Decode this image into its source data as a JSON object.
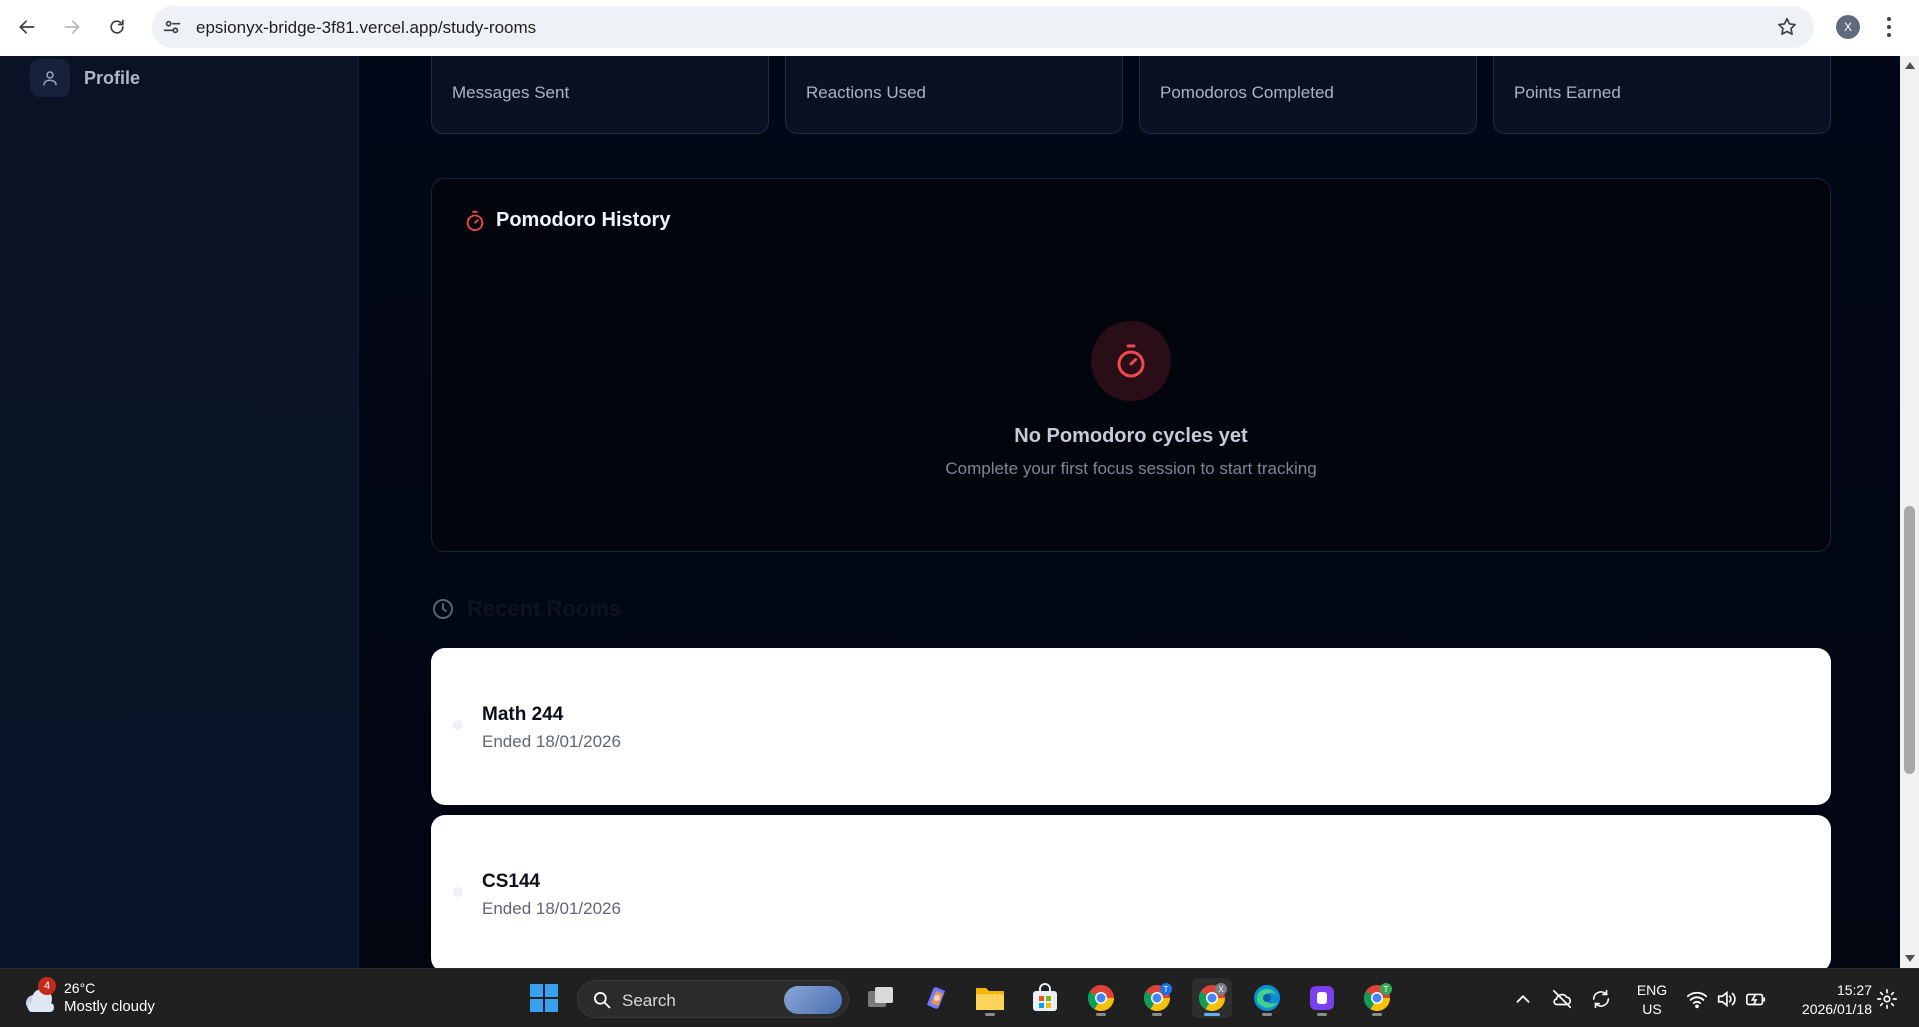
{
  "browser": {
    "url": "epsionyx-bridge-3f81.vercel.app/study-rooms",
    "profile_initial": "X"
  },
  "sidebar": {
    "items": [
      {
        "label": "Profile",
        "icon": "user-icon"
      }
    ]
  },
  "stats": {
    "cards": [
      {
        "label": "Messages Sent"
      },
      {
        "label": "Reactions Used"
      },
      {
        "label": "Pomodoros Completed"
      },
      {
        "label": "Points Earned"
      }
    ]
  },
  "pomodoro": {
    "title": "Pomodoro History",
    "empty_title": "No Pomodoro cycles yet",
    "empty_subtitle": "Complete your first focus session to start tracking",
    "accent_color": "#ef4444"
  },
  "recent_rooms": {
    "title": "Recent Rooms",
    "rooms": [
      {
        "name": "Math 244",
        "status": "Ended 18/01/2026"
      },
      {
        "name": "CS144",
        "status": "Ended 18/01/2026"
      }
    ]
  },
  "taskbar": {
    "weather": {
      "badge": "4",
      "temp": "26°C",
      "condition": "Mostly cloudy"
    },
    "search_placeholder": "Search",
    "language": {
      "line1": "ENG",
      "line2": "US"
    },
    "clock": {
      "time": "15:27",
      "date": "2026/01/18"
    },
    "chrome_badge_t": "T",
    "chrome_badge_x": "X"
  }
}
